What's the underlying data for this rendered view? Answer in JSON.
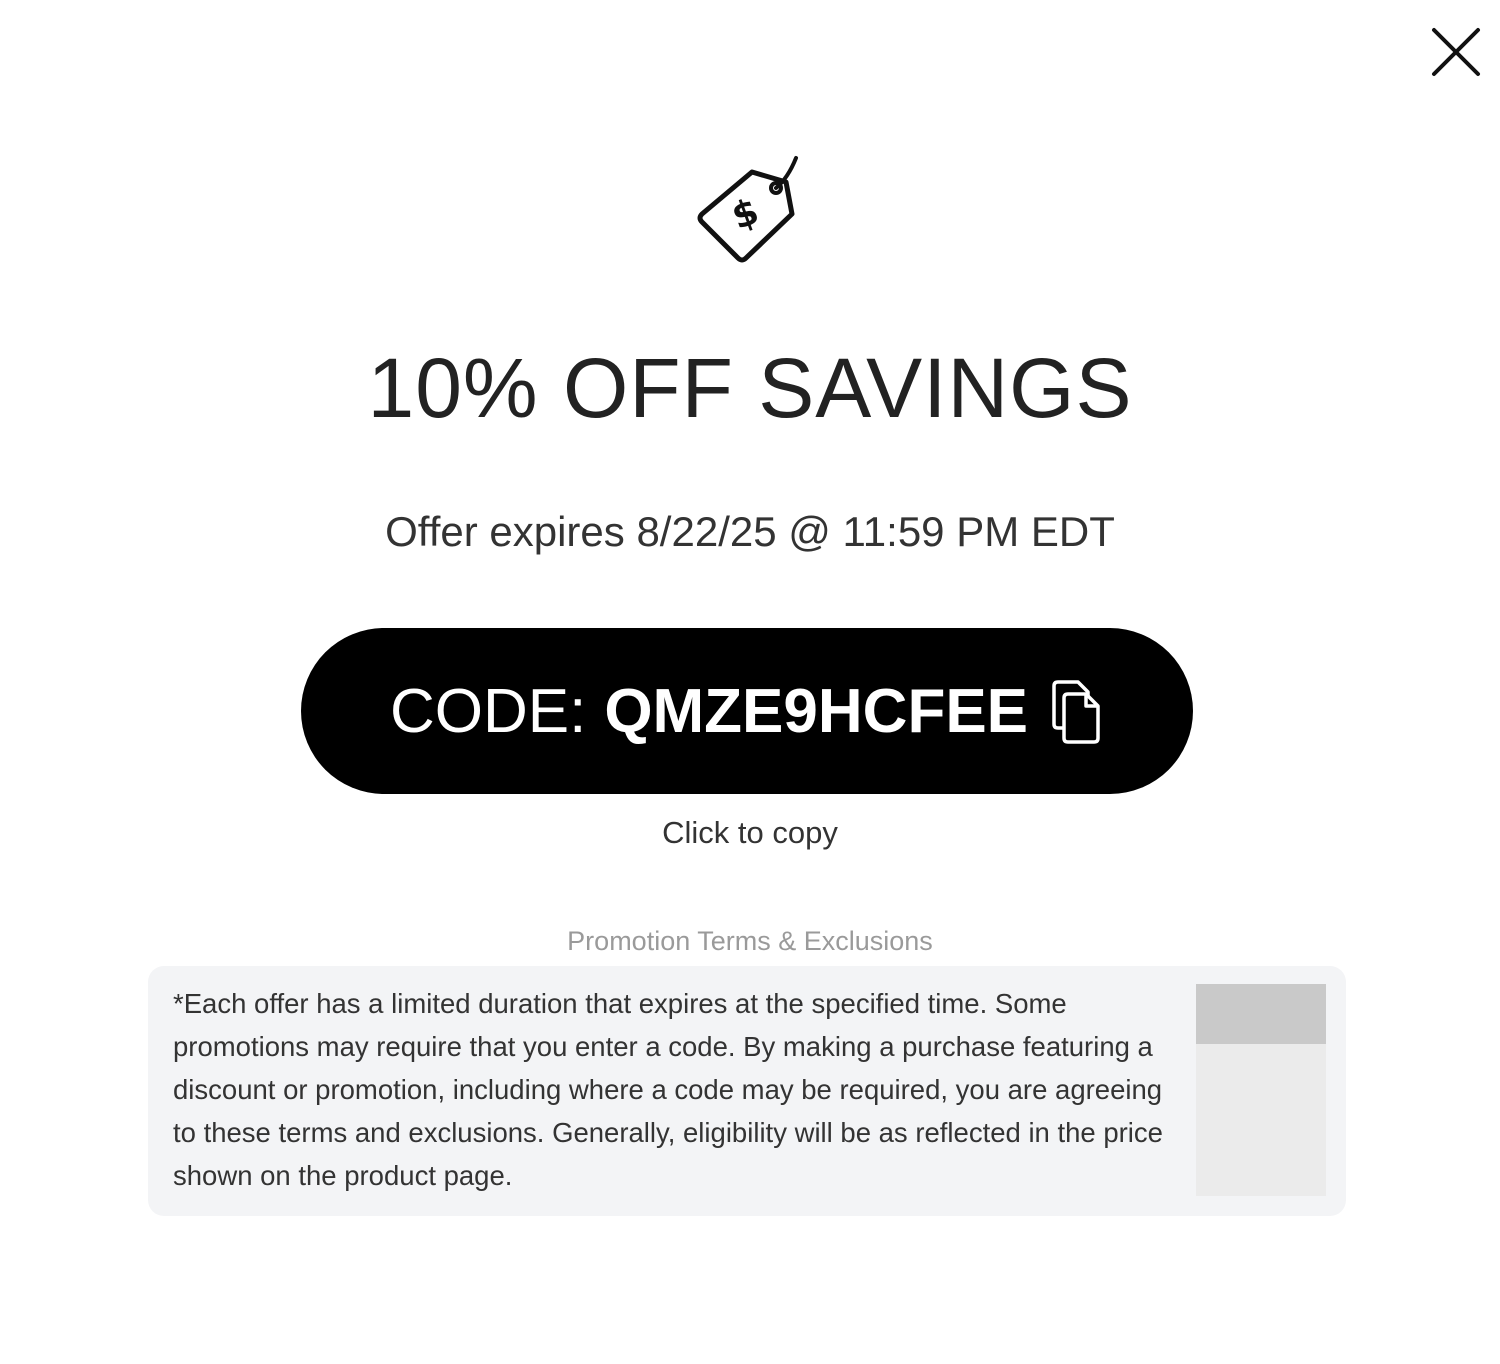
{
  "modal": {
    "close_icon": "close-icon",
    "tag_icon": "price-tag-dollar-icon",
    "title": "10% OFF SAVINGS",
    "expires_text": "Offer expires 8/22/25 @ 11:59 PM EDT",
    "code_button": {
      "prefix": "CODE:",
      "code": "QMZE9HCFEE",
      "icon": "copy-icon",
      "background": "#000000",
      "text_color": "#ffffff"
    },
    "click_to_copy": "Click to copy",
    "terms": {
      "heading": "Promotion Terms & Exclusions",
      "text": "*Each offer has a limited duration that expires at the specified time. Some promotions may require that you enter a code. By making a purchase featuring a discount or promotion, including where a code may be required, you are agreeing to these terms and exclusions. Generally, eligibility will be as reflected in the price shown on the product page."
    }
  }
}
